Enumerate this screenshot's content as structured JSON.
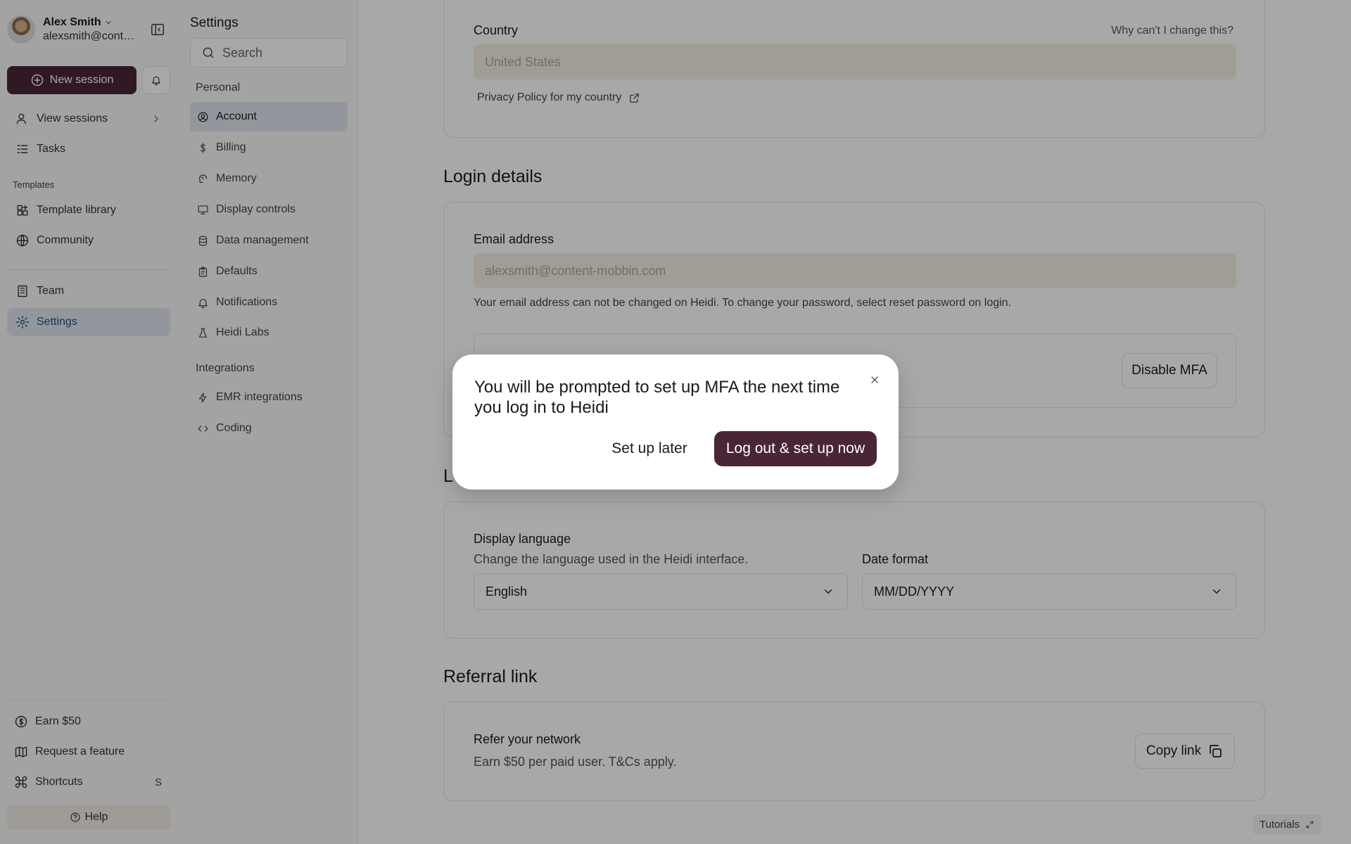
{
  "user": {
    "name": "Alex Smith",
    "email": "alexsmith@conte..."
  },
  "sidebar": {
    "new_session": "New session",
    "nav": [
      {
        "label": "View sessions",
        "icon": "user-icon"
      },
      {
        "label": "Tasks",
        "icon": "tasks-icon"
      }
    ],
    "templates_heading": "Templates",
    "templates": [
      {
        "label": "Template library",
        "icon": "template-icon"
      },
      {
        "label": "Community",
        "icon": "globe-icon"
      }
    ],
    "workspace": [
      {
        "label": "Team",
        "icon": "building-icon"
      },
      {
        "label": "Settings",
        "icon": "gear-icon"
      }
    ],
    "bottom": [
      {
        "label": "Earn $50",
        "icon": "dollar-circle-icon"
      },
      {
        "label": "Request a feature",
        "icon": "map-icon"
      },
      {
        "label": "Shortcuts",
        "icon": "command-icon",
        "key": "S"
      }
    ],
    "help": "Help"
  },
  "settings": {
    "title": "Settings",
    "search_placeholder": "Search",
    "personal_heading": "Personal",
    "personal": [
      {
        "label": "Account",
        "icon": "user-circle-icon",
        "active": true
      },
      {
        "label": "Billing",
        "icon": "dollar-icon"
      },
      {
        "label": "Memory",
        "icon": "memory-icon"
      },
      {
        "label": "Display controls",
        "icon": "monitor-icon"
      },
      {
        "label": "Data management",
        "icon": "database-icon"
      },
      {
        "label": "Defaults",
        "icon": "clipboard-icon"
      },
      {
        "label": "Notifications",
        "icon": "bell-icon"
      },
      {
        "label": "Heidi Labs",
        "icon": "flask-icon"
      }
    ],
    "integrations_heading": "Integrations",
    "integrations": [
      {
        "label": "EMR integrations",
        "icon": "zap-icon"
      },
      {
        "label": "Coding",
        "icon": "code-icon"
      }
    ]
  },
  "account": {
    "country_label": "Country",
    "country_why": "Why can't I change this?",
    "country_value": "United States",
    "privacy_link": "Privacy Policy for my country",
    "login_heading": "Login details",
    "email_label": "Email address",
    "email_value": "alexsmith@content-mobbin.com",
    "email_help": "Your email address can not be changed on Heidi. To change your password, select reset password on login.",
    "disable_mfa": "Disable MFA",
    "language_heading_partial": "L",
    "display_language_label": "Display language",
    "display_language_desc": "Change the language used in the Heidi interface.",
    "display_language_value": "English",
    "date_format_label": "Date format",
    "date_format_value": "MM/DD/YYYY",
    "referral_heading": "Referral link",
    "referral_label": "Refer your network",
    "referral_desc": "Earn $50 per paid user. T&Cs apply.",
    "copy_link": "Copy link"
  },
  "tutorials": "Tutorials",
  "modal": {
    "message": "You will be prompted to set up MFA the next time you log in to Heidi",
    "later": "Set up later",
    "now": "Log out & set up now"
  },
  "colors": {
    "brand": "#4a2538",
    "active_bg": "#dfe6ee",
    "input_bg": "#f5efe1"
  }
}
